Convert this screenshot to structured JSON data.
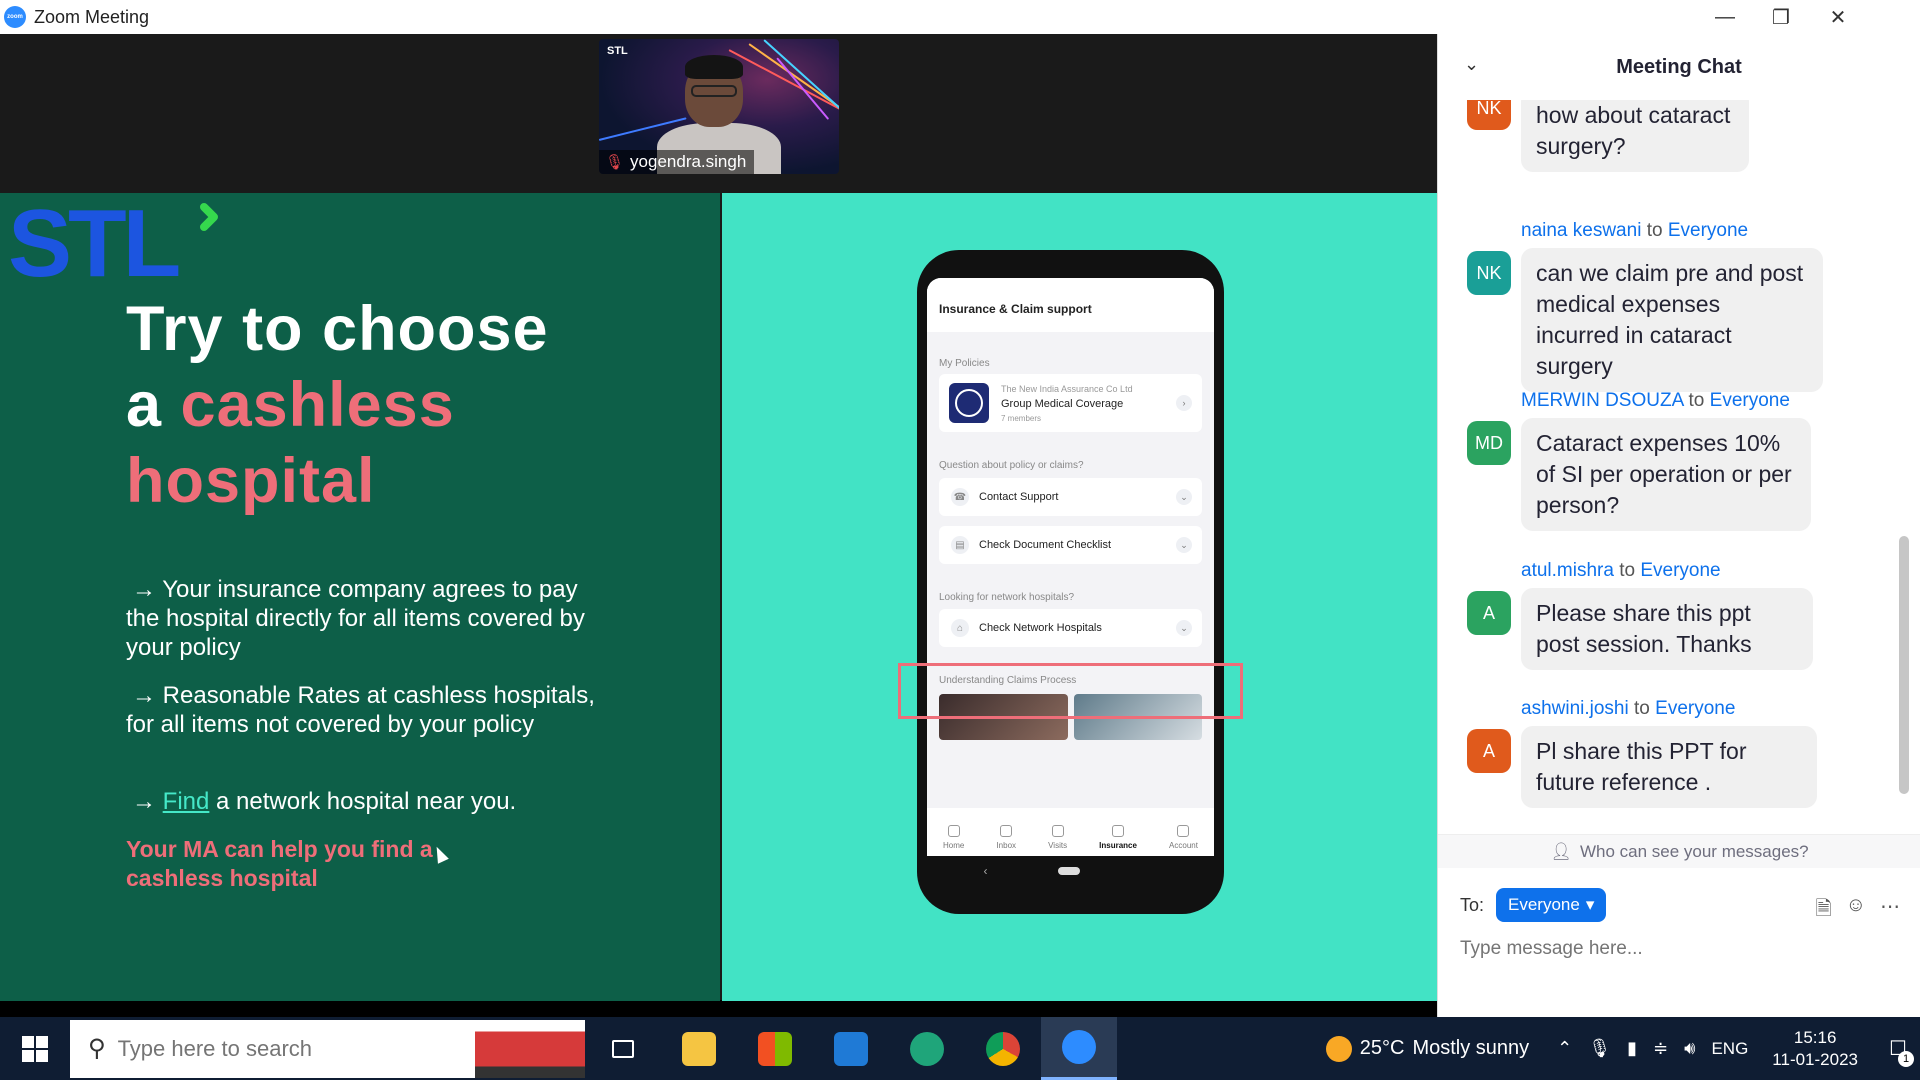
{
  "window": {
    "title": "Zoom Meeting",
    "logo_text": "zoom"
  },
  "participant": {
    "name": "yogendra.singh",
    "brand": "STL"
  },
  "slide": {
    "logo": "STL",
    "headline_line1": "Try to choose",
    "headline_line2a": "a ",
    "headline_line2b": "cashless",
    "headline_line3": "hospital",
    "bullet1": "Your insurance company agrees to pay the hospital directly for all items covered by your policy",
    "bullet2": "Reasonable Rates at cashless hospitals, for all items not covered by your policy",
    "bullet3_link": "Find",
    "bullet3_rest": " a network hospital near you.",
    "arrow": "→",
    "note": "Your MA can help you find a cashless hospital",
    "colors": {
      "left_bg": "#0d5f48",
      "right_bg": "#42e3c5",
      "accent": "#ee6e79"
    }
  },
  "phone": {
    "header": "Insurance & Claim support",
    "sec_policies": "My Policies",
    "policy_company": "The New India Assurance Co Ltd",
    "policy_name": "Group Medical Coverage",
    "policy_members": "7 members",
    "sec_question": "Question about policy or claims?",
    "contact_support": "Contact Support",
    "document_checklist": "Check Document Checklist",
    "sec_network": "Looking for network hospitals?",
    "network_hospitals": "Check Network Hospitals",
    "sec_claims": "Understanding Claims Process",
    "nav": [
      "Home",
      "Inbox",
      "Visits",
      "Insurance",
      "Account"
    ]
  },
  "chat": {
    "title": "Meeting Chat",
    "to_word": "to",
    "messages": [
      {
        "initials": "NK",
        "sender": "",
        "recipient": "",
        "text": "how about cataract surgery?",
        "color": "#e05a1c"
      },
      {
        "initials": "NK",
        "sender": "naina keswani",
        "recipient": "Everyone",
        "text": "can we claim pre and post medical expenses incurred in cataract  surgery",
        "color": "#1a9f97"
      },
      {
        "initials": "MD",
        "sender": "MERWIN DSOUZA",
        "recipient": "Everyone",
        "text": "Cataract expenses 10% of SI per operation or per person?",
        "color": "#2ba360"
      },
      {
        "initials": "A",
        "sender": "atul.mishra",
        "recipient": "Everyone",
        "text": "Please share this ppt post session. Thanks",
        "color": "#2ba360"
      },
      {
        "initials": "A",
        "sender": "ashwini.joshi",
        "recipient": "Everyone",
        "text": "Pl share this PPT for future reference .",
        "color": "#e05a1c"
      }
    ],
    "privacy_text": "Who can see your messages?",
    "to_label": "To:",
    "to_value": "Everyone",
    "compose_placeholder": "Type message here..."
  },
  "taskbar": {
    "search_placeholder": "Type here to search",
    "weather_temp": "25°C",
    "weather_text": "Mostly sunny",
    "language": "ENG",
    "time": "15:16",
    "date": "11-01-2023",
    "notification_count": "1"
  }
}
